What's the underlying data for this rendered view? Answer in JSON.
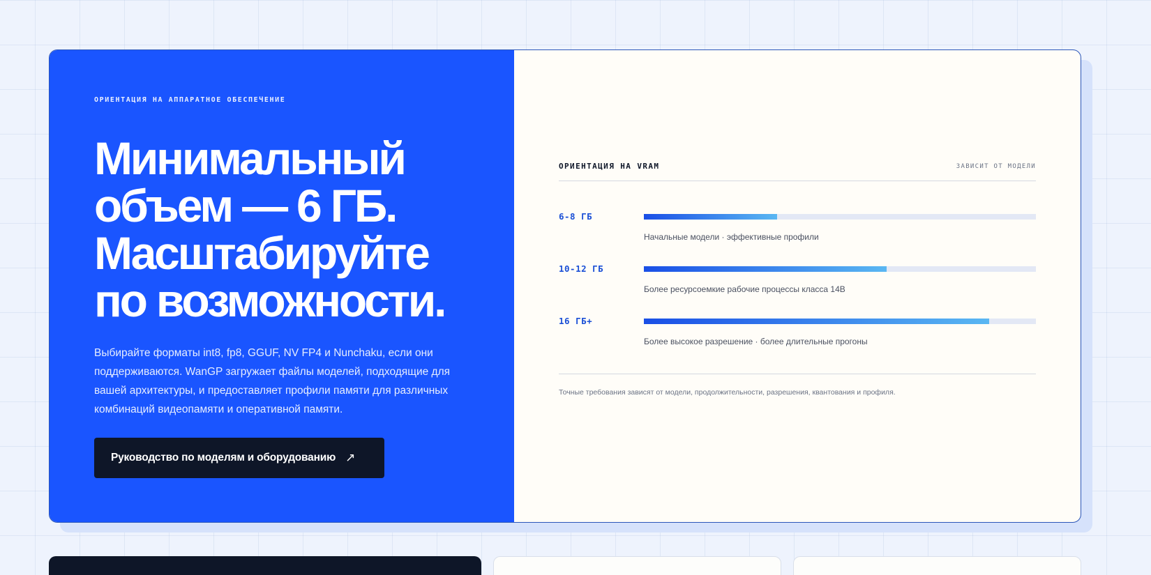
{
  "hero": {
    "eyebrow": "ОРИЕНТАЦИЯ НА АППАРАТНОЕ ОБЕСПЕЧЕНИЕ",
    "headline": "Минимальный объем — 6 ГБ. Масштабируйте по возможности.",
    "description": "Выбирайте форматы int8, fp8, GGUF, NV FP4 и Nunchaku, если они поддерживаются. WanGP загружает файлы моделей, подходящие для вашей архитектуры, и предоставляет профили памяти для различных комбинаций видеопамяти и оперативной памяти.",
    "cta_label": "Руководство по моделям и оборудованию",
    "cta_icon": "arrow-up-right-icon"
  },
  "vram": {
    "title": "ОРИЕНТАЦИЯ НА VRAM",
    "note": "ЗАВИСИТ ОТ МОДЕЛИ",
    "tiers": [
      {
        "label": "6-8 ГБ",
        "fill": 0.34,
        "description": "Начальные модели · эффективные профили"
      },
      {
        "label": "10-12 ГБ",
        "fill": 0.62,
        "description": "Более ресурсоемкие рабочие процессы класса 14B"
      },
      {
        "label": "16 ГБ+",
        "fill": 0.88,
        "description": "Более высокое разрешение · более длительные прогоны"
      }
    ],
    "footnote": "Точные требования зависят от модели, продолжительности, разрешения, квантования и профиля."
  },
  "colors": {
    "accent": "#1a55ff",
    "dark": "#0e1628",
    "background": "#eef3fd"
  }
}
